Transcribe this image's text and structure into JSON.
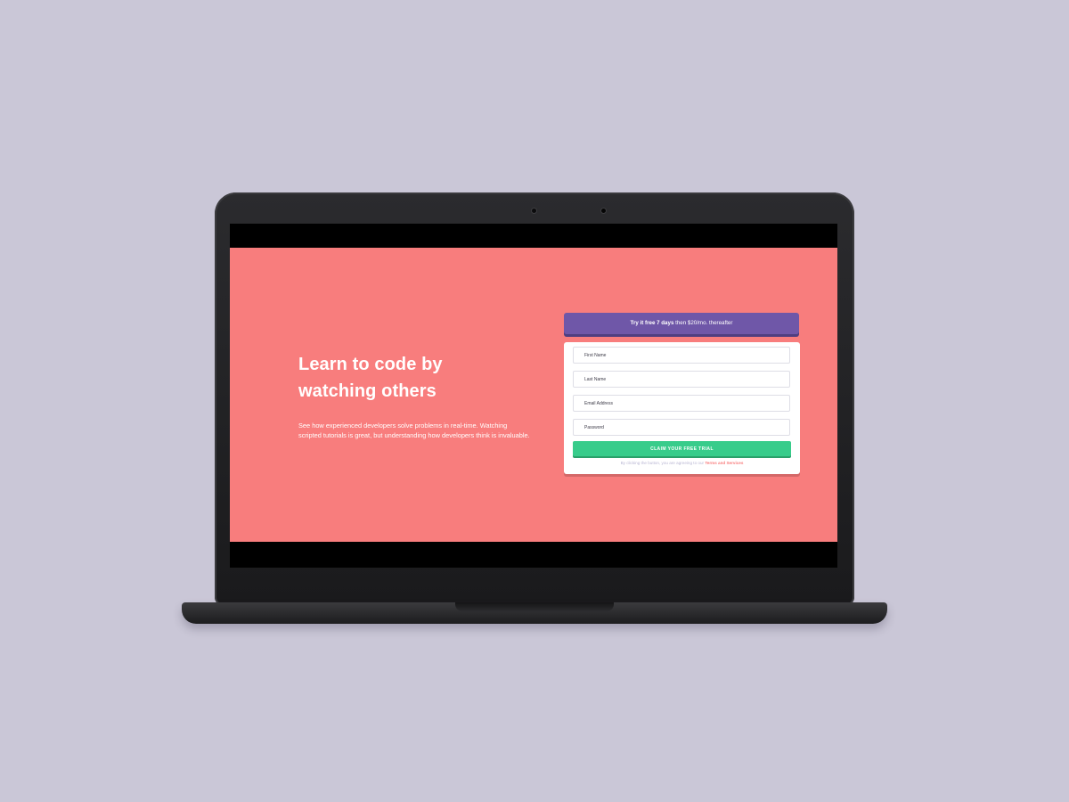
{
  "hero": {
    "title": "Learn to code by watching others",
    "description": "See how experienced developers solve problems in real-time. Watching scripted tutorials is great, but understanding how developers think is invaluable."
  },
  "offer_banner": {
    "bold_text": "Try it free 7 days",
    "rest_text": " then $20/mo. thereafter"
  },
  "form": {
    "first_name_placeholder": "First Name",
    "last_name_placeholder": "Last Name",
    "email_placeholder": "Email Address",
    "password_placeholder": "Password",
    "submit_label": "CLAIM YOUR FREE TRIAL",
    "terms_prefix": "By clicking the button, you are agreeing to our ",
    "terms_link": "Terms and Services"
  },
  "colors": {
    "page_background": "#cac7d7",
    "hero_background": "#f87d7d",
    "banner_purple": "#6f57a8",
    "button_green": "#38cc8b"
  }
}
